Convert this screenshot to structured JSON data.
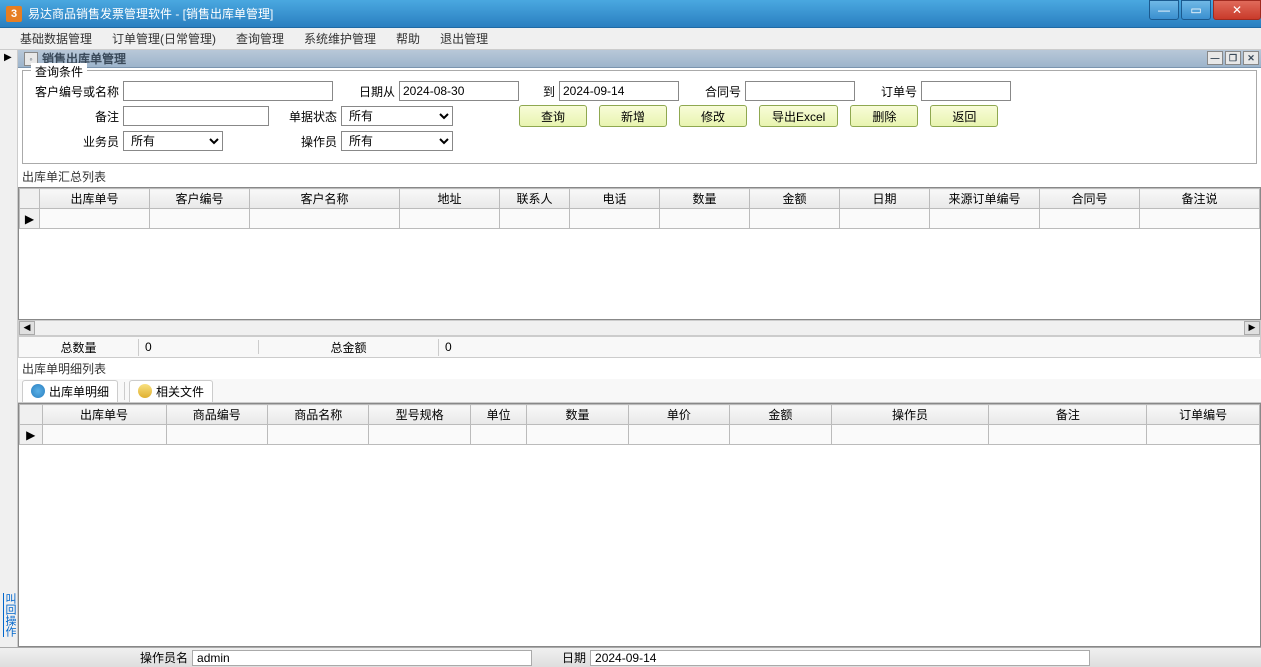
{
  "window": {
    "app_icon_text": "3",
    "title": "易达商品销售发票管理软件  - [销售出库单管理]"
  },
  "menubar": {
    "items": [
      "基础数据管理",
      "订单管理(日常管理)",
      "查询管理",
      "系统维护管理",
      "帮助",
      "退出管理"
    ]
  },
  "subwindow": {
    "title": "销售出库单管理"
  },
  "query": {
    "legend": "查询条件",
    "customer_label": "客户编号或名称",
    "customer_value": "",
    "date_from_label": "日期从",
    "date_from_value": "2024-08-30",
    "date_to_label": "到",
    "date_to_value": "2024-09-14",
    "contract_label": "合同号",
    "contract_value": "",
    "order_label": "订单号",
    "order_value": "",
    "remark_label": "备注",
    "remark_value": "",
    "status_label": "单据状态",
    "status_value": "所有",
    "salesman_label": "业务员",
    "salesman_value": "所有",
    "operator_label": "操作员",
    "operator_value": "所有",
    "btn_query": "查询",
    "btn_new": "新增",
    "btn_edit": "修改",
    "btn_export": "导出Excel",
    "btn_delete": "删除",
    "btn_return": "返回"
  },
  "summary_grid": {
    "title": "出库单汇总列表",
    "columns": [
      "出库单号",
      "客户编号",
      "客户名称",
      "地址",
      "联系人",
      "电话",
      "数量",
      "金额",
      "日期",
      "来源订单编号",
      "合同号",
      "备注说"
    ]
  },
  "totals": {
    "qty_label": "总数量",
    "qty_value": "0",
    "amt_label": "总金额",
    "amt_value": "0"
  },
  "detail_grid": {
    "title": "出库单明细列表",
    "tab1": "出库单明细",
    "tab2": "相关文件",
    "columns": [
      "出库单号",
      "商品编号",
      "商品名称",
      "型号规格",
      "单位",
      "数量",
      "单价",
      "金额",
      "操作员",
      "备注",
      "订单编号"
    ]
  },
  "sidebar": {
    "callback_link": "叫回操作"
  },
  "statusbar": {
    "operator_label": "操作员名",
    "operator_value": "admin",
    "date_label": "日期",
    "date_value": "2024-09-14"
  }
}
